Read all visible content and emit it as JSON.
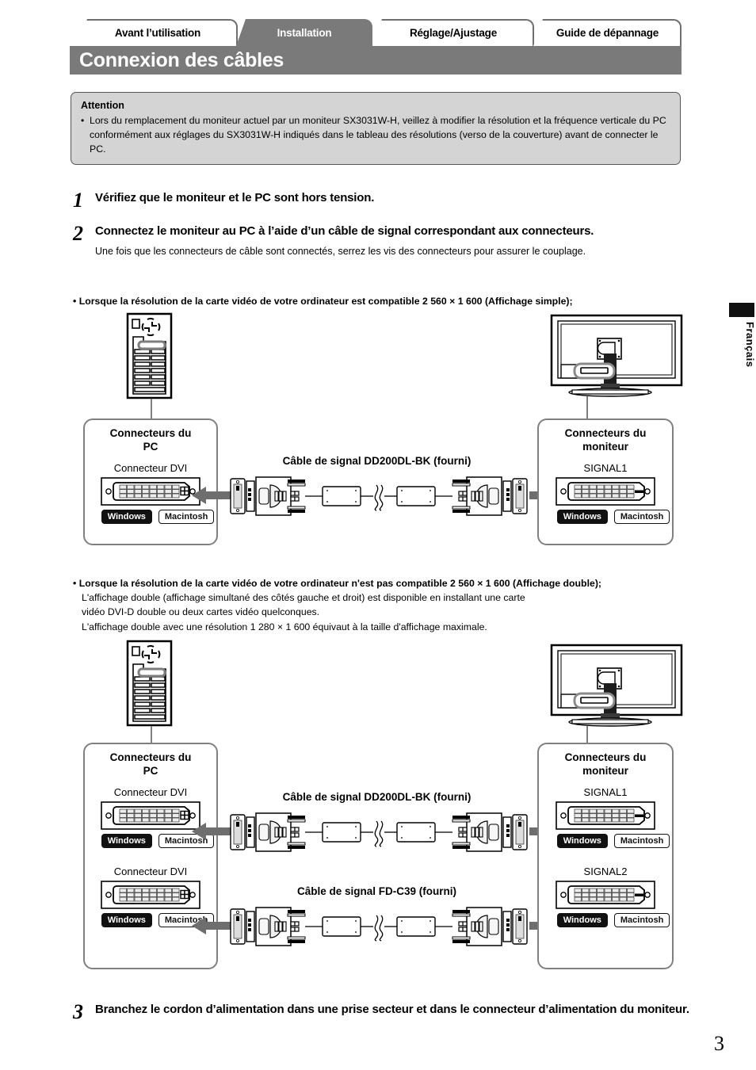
{
  "nav": {
    "tabs": [
      {
        "label": "Avant l’utilisation",
        "active": false
      },
      {
        "label": "Installation",
        "active": true
      },
      {
        "label": "Réglage/Ajustage",
        "active": false
      },
      {
        "label": "Guide de dépannage",
        "active": false
      }
    ]
  },
  "header": {
    "title": "Connexion des câbles"
  },
  "side_tab": {
    "label": "Français"
  },
  "attention": {
    "title": "Attention",
    "bullet": "•",
    "text": "Lors du remplacement du moniteur actuel par un moniteur SX3031W-H, veillez à modifier la résolution et la fréquence verticale du PC conformément aux réglages du SX3031W-H indiqués dans le tableau des résolutions (verso de la couverture) avant de connecter le PC."
  },
  "steps": {
    "one": {
      "num": "1",
      "head": "Vérifiez que le moniteur et le PC sont hors tension."
    },
    "two": {
      "num": "2",
      "head": "Connectez le moniteur au PC à l’aide d’un câble de signal correspondant aux connecteurs.",
      "sub": "Une fois que les connecteurs de câble sont connectés, serrez les vis des connecteurs pour assurer le couplage."
    },
    "three": {
      "num": "3",
      "head": "Branchez le cordon d’alimentation dans une prise secteur et dans le connecteur d’alimentation du moniteur."
    }
  },
  "note_single": {
    "bullet": "•",
    "text": "Lorsque la résolution de la carte vidéo de votre ordinateur est compatible 2 560 × 1 600 (Affichage simple);"
  },
  "note_dual": {
    "bullet": "•",
    "text": "Lorsque la résolution de la carte vidéo de votre ordinateur n'est pas compatible 2 560 × 1 600 (Affichage double);",
    "line2": "L'affichage double (affichage simultané des côtés gauche et droit) est disponible en installant une carte",
    "line3": "vidéo DVI-D double ou deux cartes vidéo quelconques.",
    "line4": "L'affichage double avec une résolution 1 280 × 1 600 équivaut à la taille d'affichage maximale."
  },
  "diagram_single": {
    "pc_panel": {
      "title_line1": "Connecteurs du",
      "title_line2": "PC"
    },
    "monitor_panel": {
      "title_line1": "Connecteurs du",
      "title_line2": "moniteur"
    },
    "pc_connector_label": "Connecteur DVI",
    "monitor_connector_label": "SIGNAL1",
    "cable_label": "Câble de signal DD200DL-BK (fourni)",
    "os_windows": "Windows",
    "os_macintosh": "Macintosh"
  },
  "diagram_dual": {
    "pc_panel": {
      "title_line1": "Connecteurs du",
      "title_line2": "PC"
    },
    "monitor_panel": {
      "title_line1": "Connecteurs du",
      "title_line2": "moniteur"
    },
    "pc_connector_label_1": "Connecteur DVI",
    "pc_connector_label_2": "Connecteur DVI",
    "monitor_connector_label_1": "SIGNAL1",
    "monitor_connector_label_2": "SIGNAL2",
    "cable_label_1": "Câble de signal DD200DL-BK (fourni)",
    "cable_label_2": "Câble de signal FD-C39 (fourni)",
    "os_windows": "Windows",
    "os_macintosh": "Macintosh"
  },
  "page_number": "3",
  "colors": {
    "banner_gray": "#7a7a7a",
    "attention_bg": "#d4d4d4",
    "panel_border": "#808080",
    "arrow_gray": "#6e6e6e"
  }
}
